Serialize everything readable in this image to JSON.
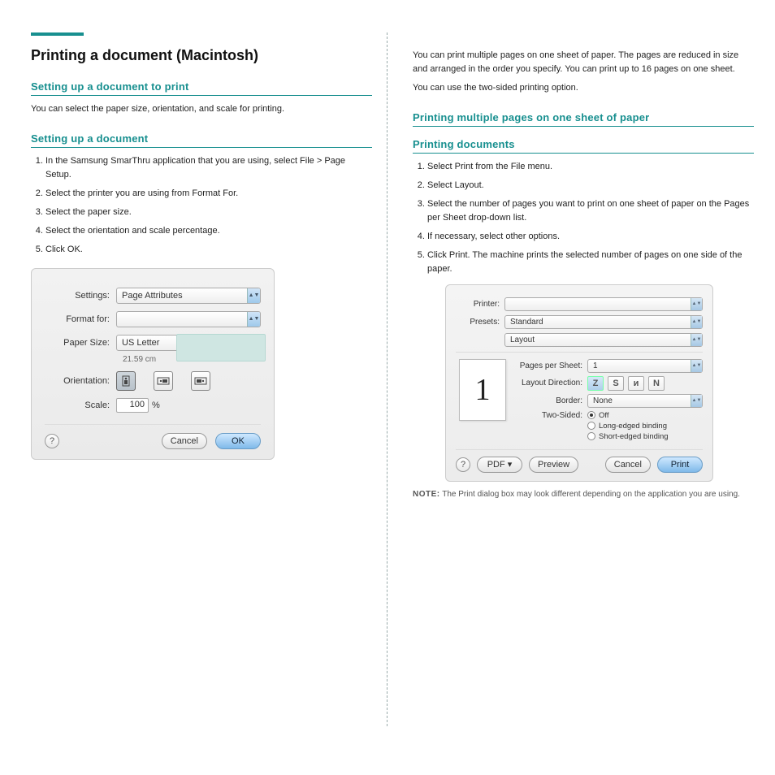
{
  "left": {
    "section_title": "Printing a document (Macintosh)",
    "sub1": "Setting up a document to print",
    "paper_body": "You can select the paper size, orientation, and scale for printing.",
    "sub2": "Setting up a document",
    "steps1": [
      "In the Samsung SmarThru application that you are using, select File > Page Setup.",
      "Select the printer you are using from Format For.",
      "Select the paper size.",
      "Select the orientation and scale percentage.",
      "Click OK."
    ]
  },
  "right": {
    "body_top1": "You can print multiple pages on one sheet of paper. The pages are reduced in size and arranged in the order you specify. You can print up to 16 pages on one sheet.",
    "body_top2": "You can use the two-sided printing option.",
    "sub1": "Printing multiple pages on one sheet of paper",
    "sub2": "Printing documents",
    "steps2": [
      "Select Print from the File menu.",
      "Select Layout.",
      "Select the number of pages you want to print on one sheet of paper on the Pages per Sheet drop-down list.",
      "If necessary, select other options.",
      "Click Print. The machine prints the selected number of pages on one side of the paper."
    ],
    "note_label": "NOTE:",
    "note_text": "The Print dialog box may look different depending on the application you are using."
  },
  "dlg1": {
    "settings_label": "Settings:",
    "settings_value": "Page Attributes",
    "format_label": "Format for:",
    "format_value": "",
    "paper_label": "Paper Size:",
    "paper_value": "US Letter",
    "paper_dim": "21.59 cm",
    "orient_label": "Orientation:",
    "scale_label": "Scale:",
    "scale_value": "100",
    "scale_pct": "%",
    "cancel": "Cancel",
    "ok": "OK",
    "help": "?"
  },
  "dlg2": {
    "printer_label": "Printer:",
    "printer_value": "",
    "presets_label": "Presets:",
    "presets_value": "Standard",
    "section_value": "Layout",
    "pps_label": "Pages per Sheet:",
    "pps_value": "1",
    "layoutdir_label": "Layout Direction:",
    "dir_icons": [
      "Z",
      "S",
      "ᴎ",
      "N"
    ],
    "border_label": "Border:",
    "border_value": "None",
    "twosided_label": "Two-Sided:",
    "radios": [
      "Off",
      "Long-edged binding",
      "Short-edged binding"
    ],
    "radio_selected": 0,
    "preview_digit": "1",
    "help": "?",
    "pdf": "PDF ▾",
    "preview": "Preview",
    "cancel": "Cancel",
    "print": "Print"
  },
  "footer": {
    "section_label": "Printing a document (Macintosh)"
  }
}
